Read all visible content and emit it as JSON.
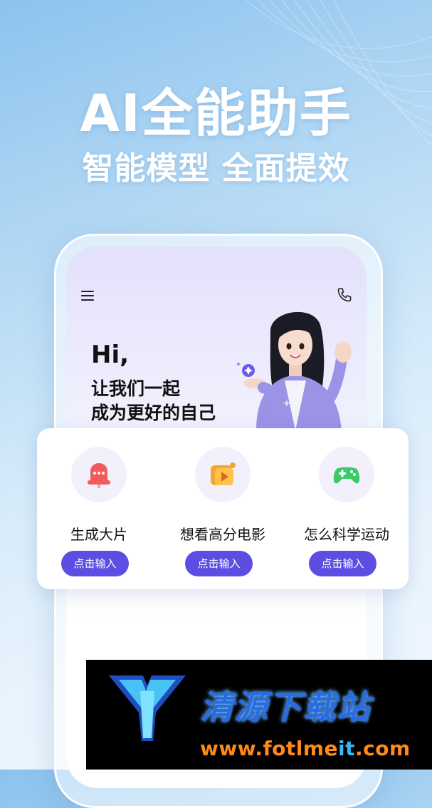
{
  "promo": {
    "headline": "AI全能助手",
    "subheadline": "智能模型 全面提效"
  },
  "app": {
    "greeting_hi": "Hi,",
    "greeting_line1": "让我们一起",
    "greeting_line2": "成为更好的自己"
  },
  "cards": [
    {
      "title": "生成大片",
      "button": "点击输入",
      "icon": "chat-bubble-icon"
    },
    {
      "title": "想看高分电影",
      "button": "点击输入",
      "icon": "video-play-icon"
    },
    {
      "title": "怎么科学运动",
      "button": "点击输入",
      "icon": "gamepad-icon"
    }
  ],
  "watermark": {
    "name": "清源下载站",
    "url_main": "www.fotlme",
    "url_accent": "it",
    "url_end": ".com"
  },
  "colors": {
    "accent": "#5d4de3",
    "background_top": "#8cc3ee",
    "background_bottom": "#f1f8fe"
  }
}
